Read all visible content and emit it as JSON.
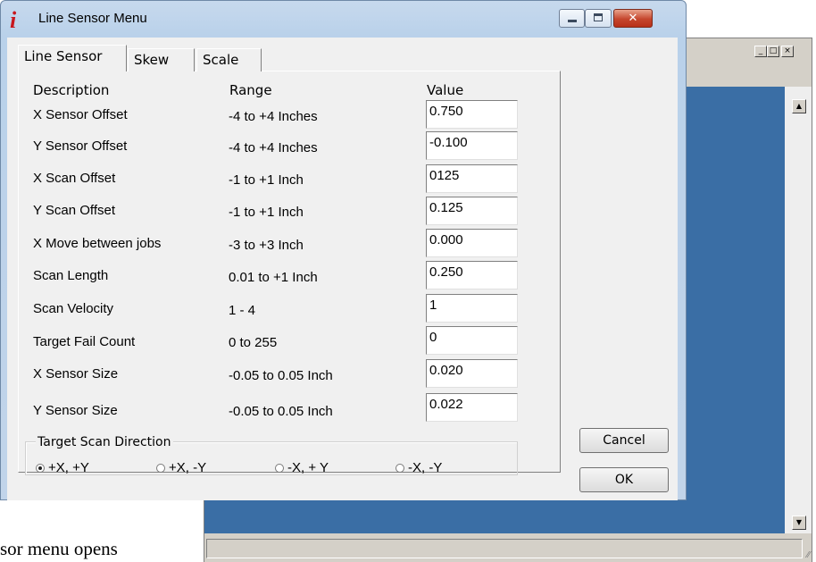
{
  "background_window": {
    "caption_buttons": [
      "_",
      "□",
      "×"
    ],
    "scroll_up": "▲",
    "scroll_down": "▼",
    "grip": "⁄⁄"
  },
  "caption_text": "sor menu opens",
  "dialog": {
    "title": "Line Sensor Menu",
    "logo_glyph": "i",
    "close_glyph": "✕",
    "tabs": [
      "Line Sensor",
      "Skew",
      "Scale"
    ],
    "columns": {
      "description": "Description",
      "range": "Range",
      "value": "Value"
    },
    "rows": [
      {
        "description": "X Sensor Offset",
        "range": "-4 to +4 Inches",
        "value": "0.750"
      },
      {
        "description": "Y Sensor Offset",
        "range": "-4 to +4 Inches",
        "value": "-0.100"
      },
      {
        "description": "X Scan Offset",
        "range": "-1 to +1 Inch",
        "value": "0125"
      },
      {
        "description": "Y Scan Offset",
        "range": "-1 to +1 Inch",
        "value": "0.125"
      },
      {
        "description": "X Move between jobs",
        "range": "-3 to +3 Inch",
        "value": "0.000"
      },
      {
        "description": "Scan Length",
        "range": "0.01 to +1 Inch",
        "value": "0.250"
      },
      {
        "description": "Scan Velocity",
        "range": "1 - 4",
        "value": "1"
      },
      {
        "description": "Target Fail Count",
        "range": "0 to 255",
        "value": "0"
      },
      {
        "description": "X Sensor Size",
        "range": "-0.05 to 0.05 Inch",
        "value": "0.020"
      },
      {
        "description": "Y Sensor Size",
        "range": "-0.05 to 0.05 Inch",
        "value": "0.022"
      }
    ],
    "scan_direction": {
      "label": "Target Scan Direction",
      "options": [
        "+X, +Y",
        "+X, -Y",
        "-X, + Y",
        "-X, -Y"
      ],
      "selected": "+X, +Y"
    },
    "buttons": {
      "cancel": "Cancel",
      "ok": "OK"
    }
  }
}
